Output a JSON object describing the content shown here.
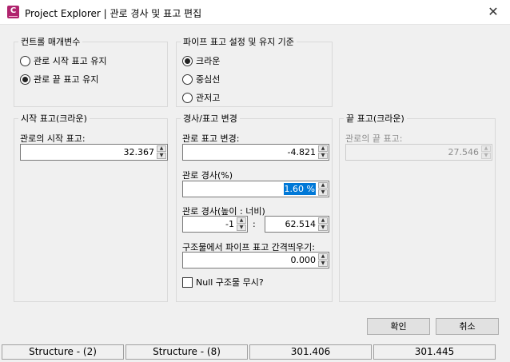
{
  "window": {
    "title": "Project Explorer | 관로 경사 및 표고 편집",
    "icon_letter": "C",
    "close_glyph": "✕"
  },
  "control_params": {
    "title": "컨트롤 매개변수",
    "options": [
      {
        "label": "관로 시작 표고 유지",
        "selected": false
      },
      {
        "label": "관로 끝 표고 유지",
        "selected": true
      }
    ]
  },
  "pipe_elevation": {
    "title": "파이프 표고 설정 및 유지 기준",
    "options": [
      {
        "label": "크라운",
        "selected": true
      },
      {
        "label": "중심선",
        "selected": false
      },
      {
        "label": "관저고",
        "selected": false
      }
    ]
  },
  "start_elev": {
    "title": "시작 표고(크라운)",
    "field_label": "관로의 시작 표고:",
    "value": "32.367"
  },
  "slope_elev": {
    "title": "경사/표고 변경",
    "change_label": "관로 표고 변경:",
    "change_value": "-4.821",
    "slope_pct_label": "관로 경사(%)",
    "slope_pct_value": "1.60 %",
    "slope_ratio_label": "관로 경사(높이 : 너비)",
    "rise_value": "-1",
    "ratio_sep": ":",
    "run_value": "62.514",
    "offset_label": "구조물에서 파이프 표고 간격띄우기:",
    "offset_value": "0.000",
    "null_struct_label": "Null 구조물 무시?"
  },
  "end_elev": {
    "title": "끝 표고(크라운)",
    "field_label": "관로의 끝 표고:",
    "value": "27.546"
  },
  "buttons": {
    "ok": "확인",
    "cancel": "취소"
  },
  "status_bar": [
    "Structure - (2)",
    "Structure - (8)",
    "301.406",
    "301.445"
  ]
}
